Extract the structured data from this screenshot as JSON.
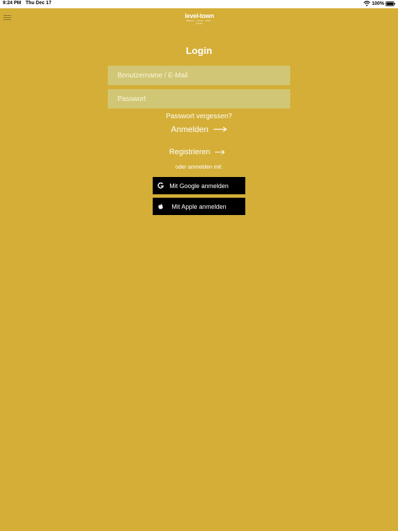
{
  "status_bar": {
    "time": "9:24 PM",
    "date": "Thu Dec 17",
    "battery": "100%"
  },
  "logo": {
    "text": "level-town",
    "tagline": "BREAK · YOUR · OWN · LEVEL"
  },
  "login": {
    "title": "Login",
    "username_placeholder": "Benutzername / E-Mail",
    "password_placeholder": "Passwort",
    "forgot_label": "Passwort vergessen?",
    "login_label": "Anmelden",
    "register_label": "Registrieren",
    "alt_label": "oder anmelden mit:",
    "google_label": "Mit Google anmelden",
    "apple_label": "Mit Apple anmelden"
  },
  "colors": {
    "background": "#d4ae36",
    "field": "#d1c675",
    "button": "#000000"
  },
  "icons": [
    "menu-icon",
    "wifi-icon",
    "battery-icon",
    "arrow-right-icon",
    "google-icon",
    "apple-icon"
  ]
}
